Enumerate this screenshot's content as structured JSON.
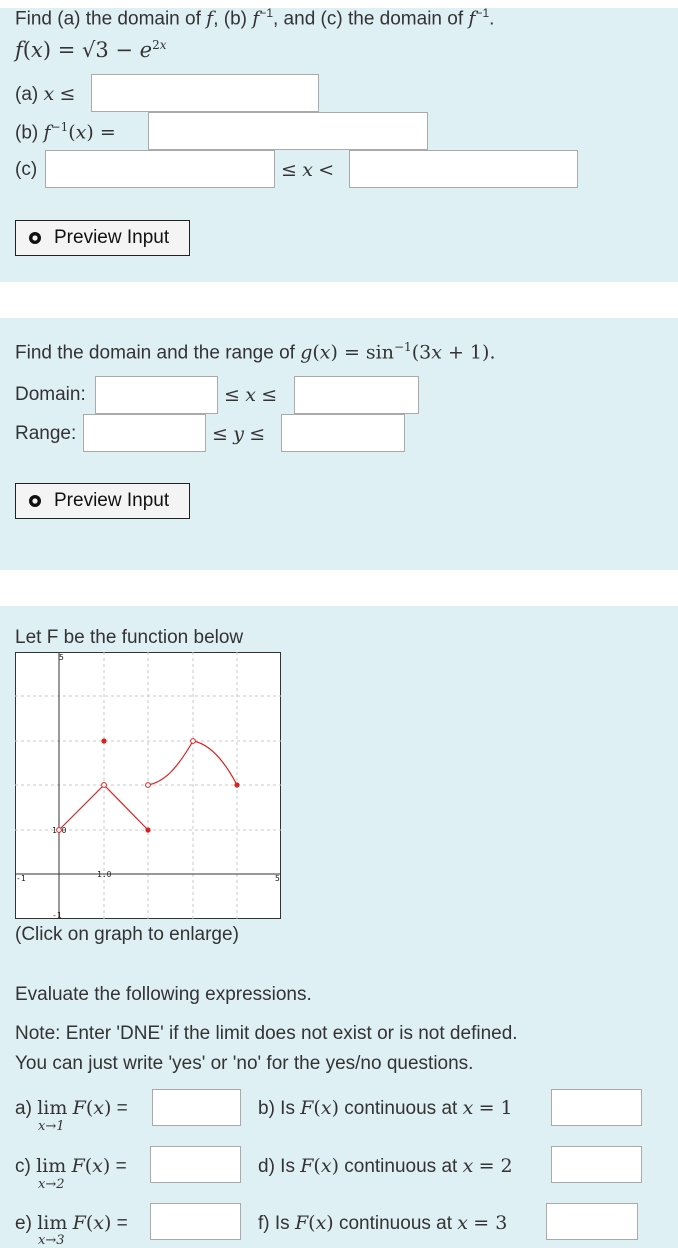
{
  "problem1": {
    "header": "Find (a) the domain of f, (b) f⁻¹, and (c) the domain of f⁻¹.",
    "function": "f(x) = √(3 − e²ˣ)",
    "a_label": "(a)",
    "a_relation": "x ≤",
    "b_label": "(b)",
    "b_relation": "f⁻¹(x) =",
    "c_label": "(c)",
    "c_relation": "≤ x <",
    "preview_label": "Preview Input"
  },
  "problem2": {
    "prompt": "Find the domain and the range of g(x) = sin⁻¹(3x + 1).",
    "domain_label": "Domain:",
    "domain_relation": "≤ x ≤",
    "range_label": "Range:",
    "range_relation": "≤ y ≤",
    "preview_label": "Preview Input"
  },
  "problem3": {
    "intro": "Let F be the function below",
    "graph_caption": "(Click on graph to enlarge)",
    "graph_tick_labels": {
      "y_top": "5",
      "x_left": "-1",
      "y_one": "1.0",
      "x_one": "1.0",
      "x_right": "5",
      "y_bottom": "-1"
    },
    "evaluate": "Evaluate the following expressions.",
    "note": "Note: Enter 'DNE' if the limit does not exist or is not defined.",
    "yesno": "You can just write 'yes' or 'no' for the yes/no questions.",
    "questions": [
      {
        "label": "a) lim F(x) =",
        "sub": "x→1"
      },
      {
        "label": "b) Is F(x) continuous at x = 1"
      },
      {
        "label": "c) lim F(x) =",
        "sub": "x→2"
      },
      {
        "label": "d) Is F(x) continuous at x = 2"
      },
      {
        "label": "e) lim F(x) =",
        "sub": "x→3"
      },
      {
        "label": "f) Is F(x) continuous at x = 3"
      }
    ]
  },
  "colors": {
    "panel_bg": "#dff0f5",
    "curve": "#e02020"
  }
}
